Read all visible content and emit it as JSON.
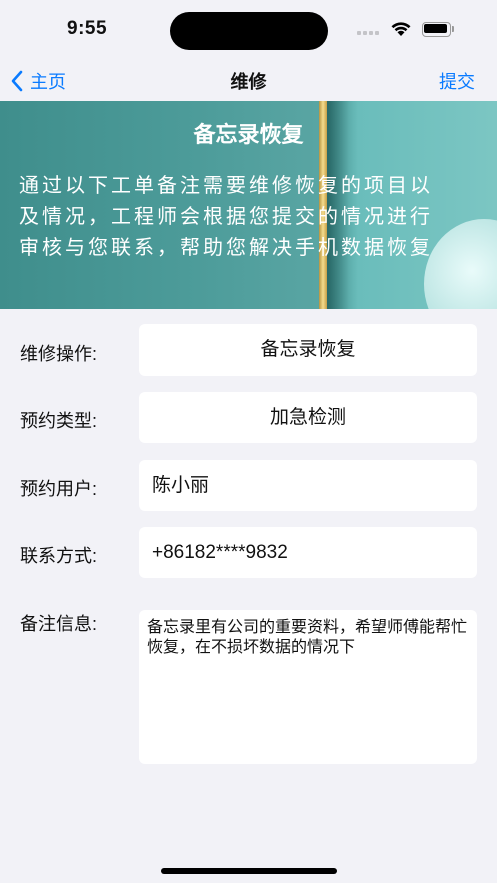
{
  "status": {
    "time": "9:55"
  },
  "nav": {
    "back_label": "主页",
    "title": "维修",
    "submit_label": "提交"
  },
  "banner": {
    "title": "备忘录恢复",
    "lines": [
      "通过以下工单备注需要维修恢复的项目以",
      "及情况，工程师会根据您提交的情况进行",
      "审核与您联系，帮助您解决手机数据恢复"
    ]
  },
  "form": {
    "operation_label": "维修操作:",
    "operation_value": "备忘录恢复",
    "type_label": "预约类型:",
    "type_value": "加急检测",
    "user_label": "预约用户:",
    "user_value": "陈小丽",
    "contact_label": "联系方式:",
    "contact_value": "+86182****9832",
    "note_label": "备注信息:",
    "note_value": "备忘录里有公司的重要资料，希望师傅能帮忙恢复，在不损坏数据的情况下"
  },
  "colors": {
    "accent": "#0a7bff",
    "banner": "#4d9c9a",
    "background": "#f2f2f7"
  }
}
